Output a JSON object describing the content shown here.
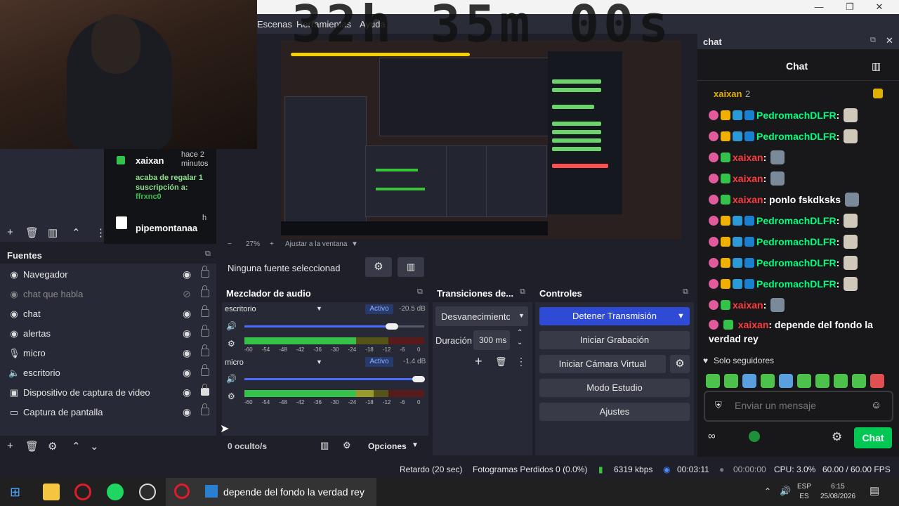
{
  "window": {
    "minimize": "—",
    "restore": "❐",
    "close": "✕"
  },
  "menu": {
    "items": [
      "Escenas",
      "Herramientas",
      "Ayuda"
    ],
    "overlay_timer": "32h 35m 00s"
  },
  "alert": {
    "user": "xaixan",
    "time": "hace 2 minutos",
    "text": "acaba de regalar 1 suscripción a:",
    "target": "ffrxnc0",
    "footer_user": "pipemontanaa",
    "footer_time": "h"
  },
  "preview": {
    "zoom": "27%",
    "fit_label": "Ajustar a la ventana"
  },
  "fuentes": {
    "title": "Fuentes",
    "items": [
      {
        "label": "Navegador",
        "icon": "globe-icon",
        "hidden": false
      },
      {
        "label": "chat que habla",
        "icon": "globe-icon",
        "hidden": true
      },
      {
        "label": "chat",
        "icon": "globe-icon",
        "hidden": false
      },
      {
        "label": "alertas",
        "icon": "globe-icon",
        "hidden": false
      },
      {
        "label": "micro",
        "icon": "mic-icon",
        "hidden": false
      },
      {
        "label": "escritorio",
        "icon": "speaker-icon",
        "hidden": false
      },
      {
        "label": "Dispositivo de captura de video",
        "icon": "camera-icon",
        "hidden": false
      },
      {
        "label": "Captura de pantalla",
        "icon": "monitor-icon",
        "hidden": false
      }
    ]
  },
  "properties": {
    "no_source": "Ninguna fuente seleccionad"
  },
  "mixer": {
    "title": "Mezclador de audio",
    "channels": [
      {
        "name": "escritorio",
        "state": "Activo",
        "db": "-20.5 dB",
        "volume": 0.82,
        "level": 0.62
      },
      {
        "name": "micro",
        "state": "Activo",
        "db": "-1.4 dB",
        "volume": 0.97,
        "level": 0.72
      }
    ],
    "scale": [
      "-60",
      "-54",
      "-48",
      "-42",
      "-36",
      "-30",
      "-24",
      "-18",
      "-12",
      "-6",
      "0"
    ],
    "hidden": "0 oculto/s",
    "options": "Opciones"
  },
  "transitions": {
    "title": "Transiciones de...",
    "selected": "Desvanecimiento",
    "duration_label": "Duración",
    "duration_value": "300 ms"
  },
  "controls": {
    "title": "Controles",
    "buttons": [
      "Detener Transmisión",
      "Iniciar Grabación",
      "Iniciar Cámara Virtual",
      "Modo Estudio",
      "Ajustes"
    ]
  },
  "status": {
    "delay": "Retardo (20 sec)",
    "dropped": "Fotogramas Perdidos 0 (0.0%)",
    "bitrate": "6319 kbps",
    "live_time": "00:03:11",
    "rec_time": "00:00:00",
    "cpu": "CPU: 3.0%",
    "fps": "60.00 / 60.00 FPS"
  },
  "chat": {
    "dock_title": "chat",
    "title": "Chat",
    "top_user": "xaixan",
    "top_count": "2",
    "messages": [
      {
        "user": "PedromachDLFR",
        "text": ":",
        "color": "#00ff7f",
        "badges": [
          "sub",
          "crown",
          "g",
          "a"
        ]
      },
      {
        "user": "PedromachDLFR",
        "text": ":",
        "color": "#00ff7f",
        "badges": [
          "sub",
          "crown",
          "g",
          "a"
        ]
      },
      {
        "user": "xaixan",
        "text": ":",
        "color": "#ff3b3b",
        "badges": [
          "sub",
          "green"
        ]
      },
      {
        "user": "xaixan",
        "text": ":",
        "color": "#ff3b3b",
        "badges": [
          "sub",
          "green"
        ]
      },
      {
        "user": "xaixan",
        "text": ": ponlo fskdksks",
        "color": "#ff3b3b",
        "badges": [
          "sub",
          "green"
        ]
      },
      {
        "user": "PedromachDLFR",
        "text": ":",
        "color": "#00ff7f",
        "badges": [
          "sub",
          "crown",
          "g",
          "a"
        ]
      },
      {
        "user": "PedromachDLFR",
        "text": ":",
        "color": "#00ff7f",
        "badges": [
          "sub",
          "crown",
          "g",
          "a"
        ]
      },
      {
        "user": "PedromachDLFR",
        "text": ":",
        "color": "#00ff7f",
        "badges": [
          "sub",
          "crown",
          "g",
          "a"
        ]
      },
      {
        "user": "PedromachDLFR",
        "text": ":",
        "color": "#00ff7f",
        "badges": [
          "sub",
          "crown",
          "g",
          "a"
        ]
      },
      {
        "user": "xaixan",
        "text": ":",
        "color": "#ff3b3b",
        "badges": [
          "sub",
          "green"
        ]
      }
    ],
    "last_user": "xaixan",
    "last_text": ": depende del fondo la",
    "last_text_2": "verdad rey",
    "followers_only": "Solo seguidores",
    "placeholder": "Enviar un mensaje",
    "send": "Chat"
  },
  "taskbar": {
    "window_title": "depende del fondo la verdad rey",
    "lang": "ESP",
    "lang2": "ES",
    "time": "6:15",
    "date": "25/08/2026"
  }
}
